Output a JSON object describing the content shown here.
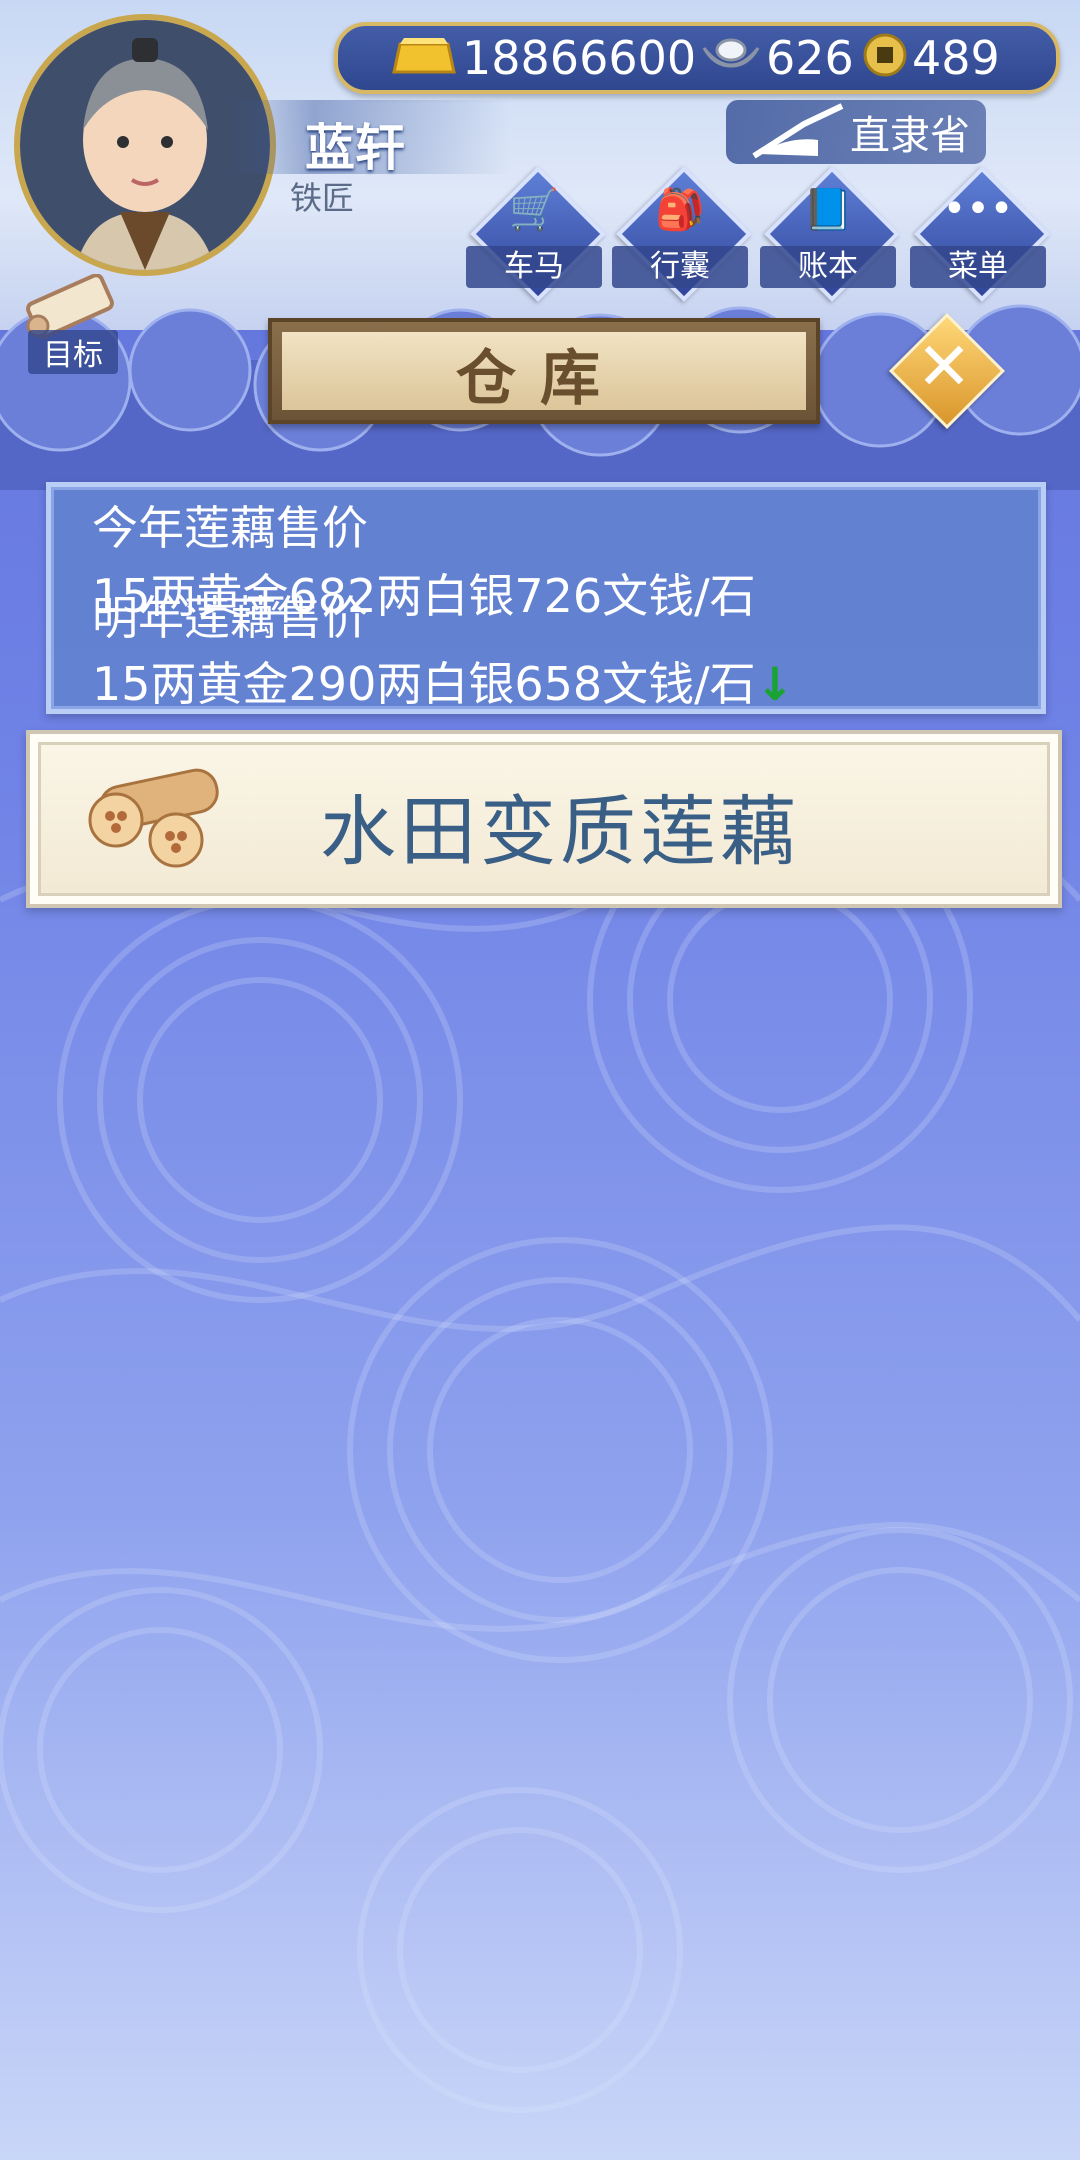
{
  "player": {
    "name": "蓝轩",
    "title": "铁匠"
  },
  "currency": {
    "gold": "18866600",
    "silver": "626",
    "coin": "489"
  },
  "region": {
    "label": "直隶省"
  },
  "menu": [
    {
      "label": "车马",
      "icon": "cart-icon"
    },
    {
      "label": "行囊",
      "icon": "bag-icon"
    },
    {
      "label": "账本",
      "icon": "ledger-icon"
    },
    {
      "label": "菜单",
      "icon": "more-icon"
    }
  ],
  "goal": {
    "label": "目标",
    "icon": "scroll-icon"
  },
  "dialog": {
    "title": "仓库",
    "close_icon": "close-icon"
  },
  "price": {
    "this_year_label": "今年莲藕售价",
    "this_year_value": "15两黄金682两白银726文钱/石",
    "next_year_label": "明年莲藕售价",
    "next_year_value": "15两黄金290两白银658文钱/石",
    "trend": "↓"
  },
  "item": {
    "name": "水田变质莲藕",
    "icon": "lotus-root-icon"
  },
  "colors": {
    "accent_gold": "#d7b865",
    "panel_blue": "#6282ce",
    "trend_down": "#19a332"
  }
}
